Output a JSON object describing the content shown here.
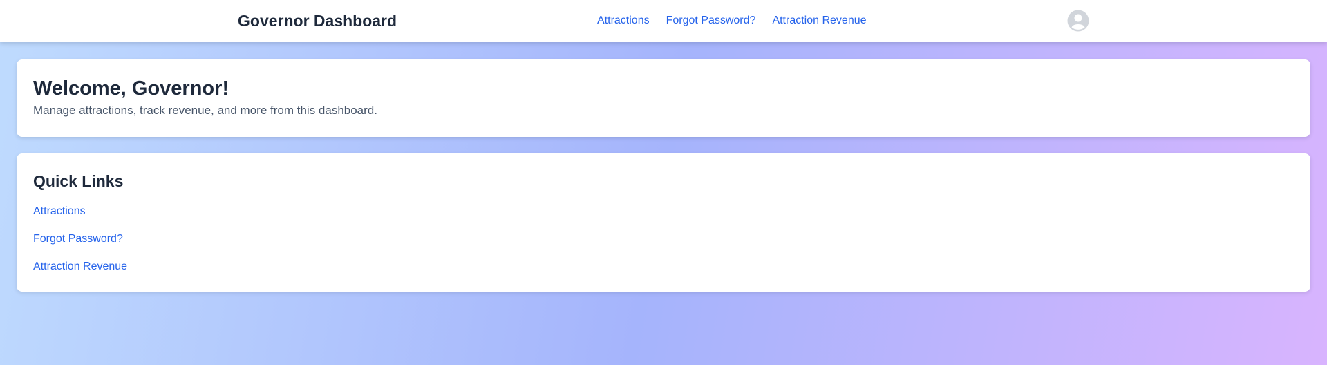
{
  "header": {
    "title": "Governor Dashboard",
    "nav": [
      {
        "label": "Attractions"
      },
      {
        "label": "Forgot Password?"
      },
      {
        "label": "Attraction Revenue"
      }
    ],
    "avatar_icon": "user-avatar-icon"
  },
  "welcome": {
    "title": "Welcome, Governor!",
    "subtitle": "Manage attractions, track revenue, and more from this dashboard."
  },
  "quick_links": {
    "title": "Quick Links",
    "links": [
      {
        "label": "Attractions"
      },
      {
        "label": "Forgot Password?"
      },
      {
        "label": "Attraction Revenue"
      }
    ]
  },
  "colors": {
    "accent": "#2563eb",
    "text_primary": "#1e293b",
    "text_secondary": "#475569",
    "gradient_start": "#bfdbfe",
    "gradient_mid": "#a5b4fc",
    "gradient_end": "#d8b4fe"
  }
}
